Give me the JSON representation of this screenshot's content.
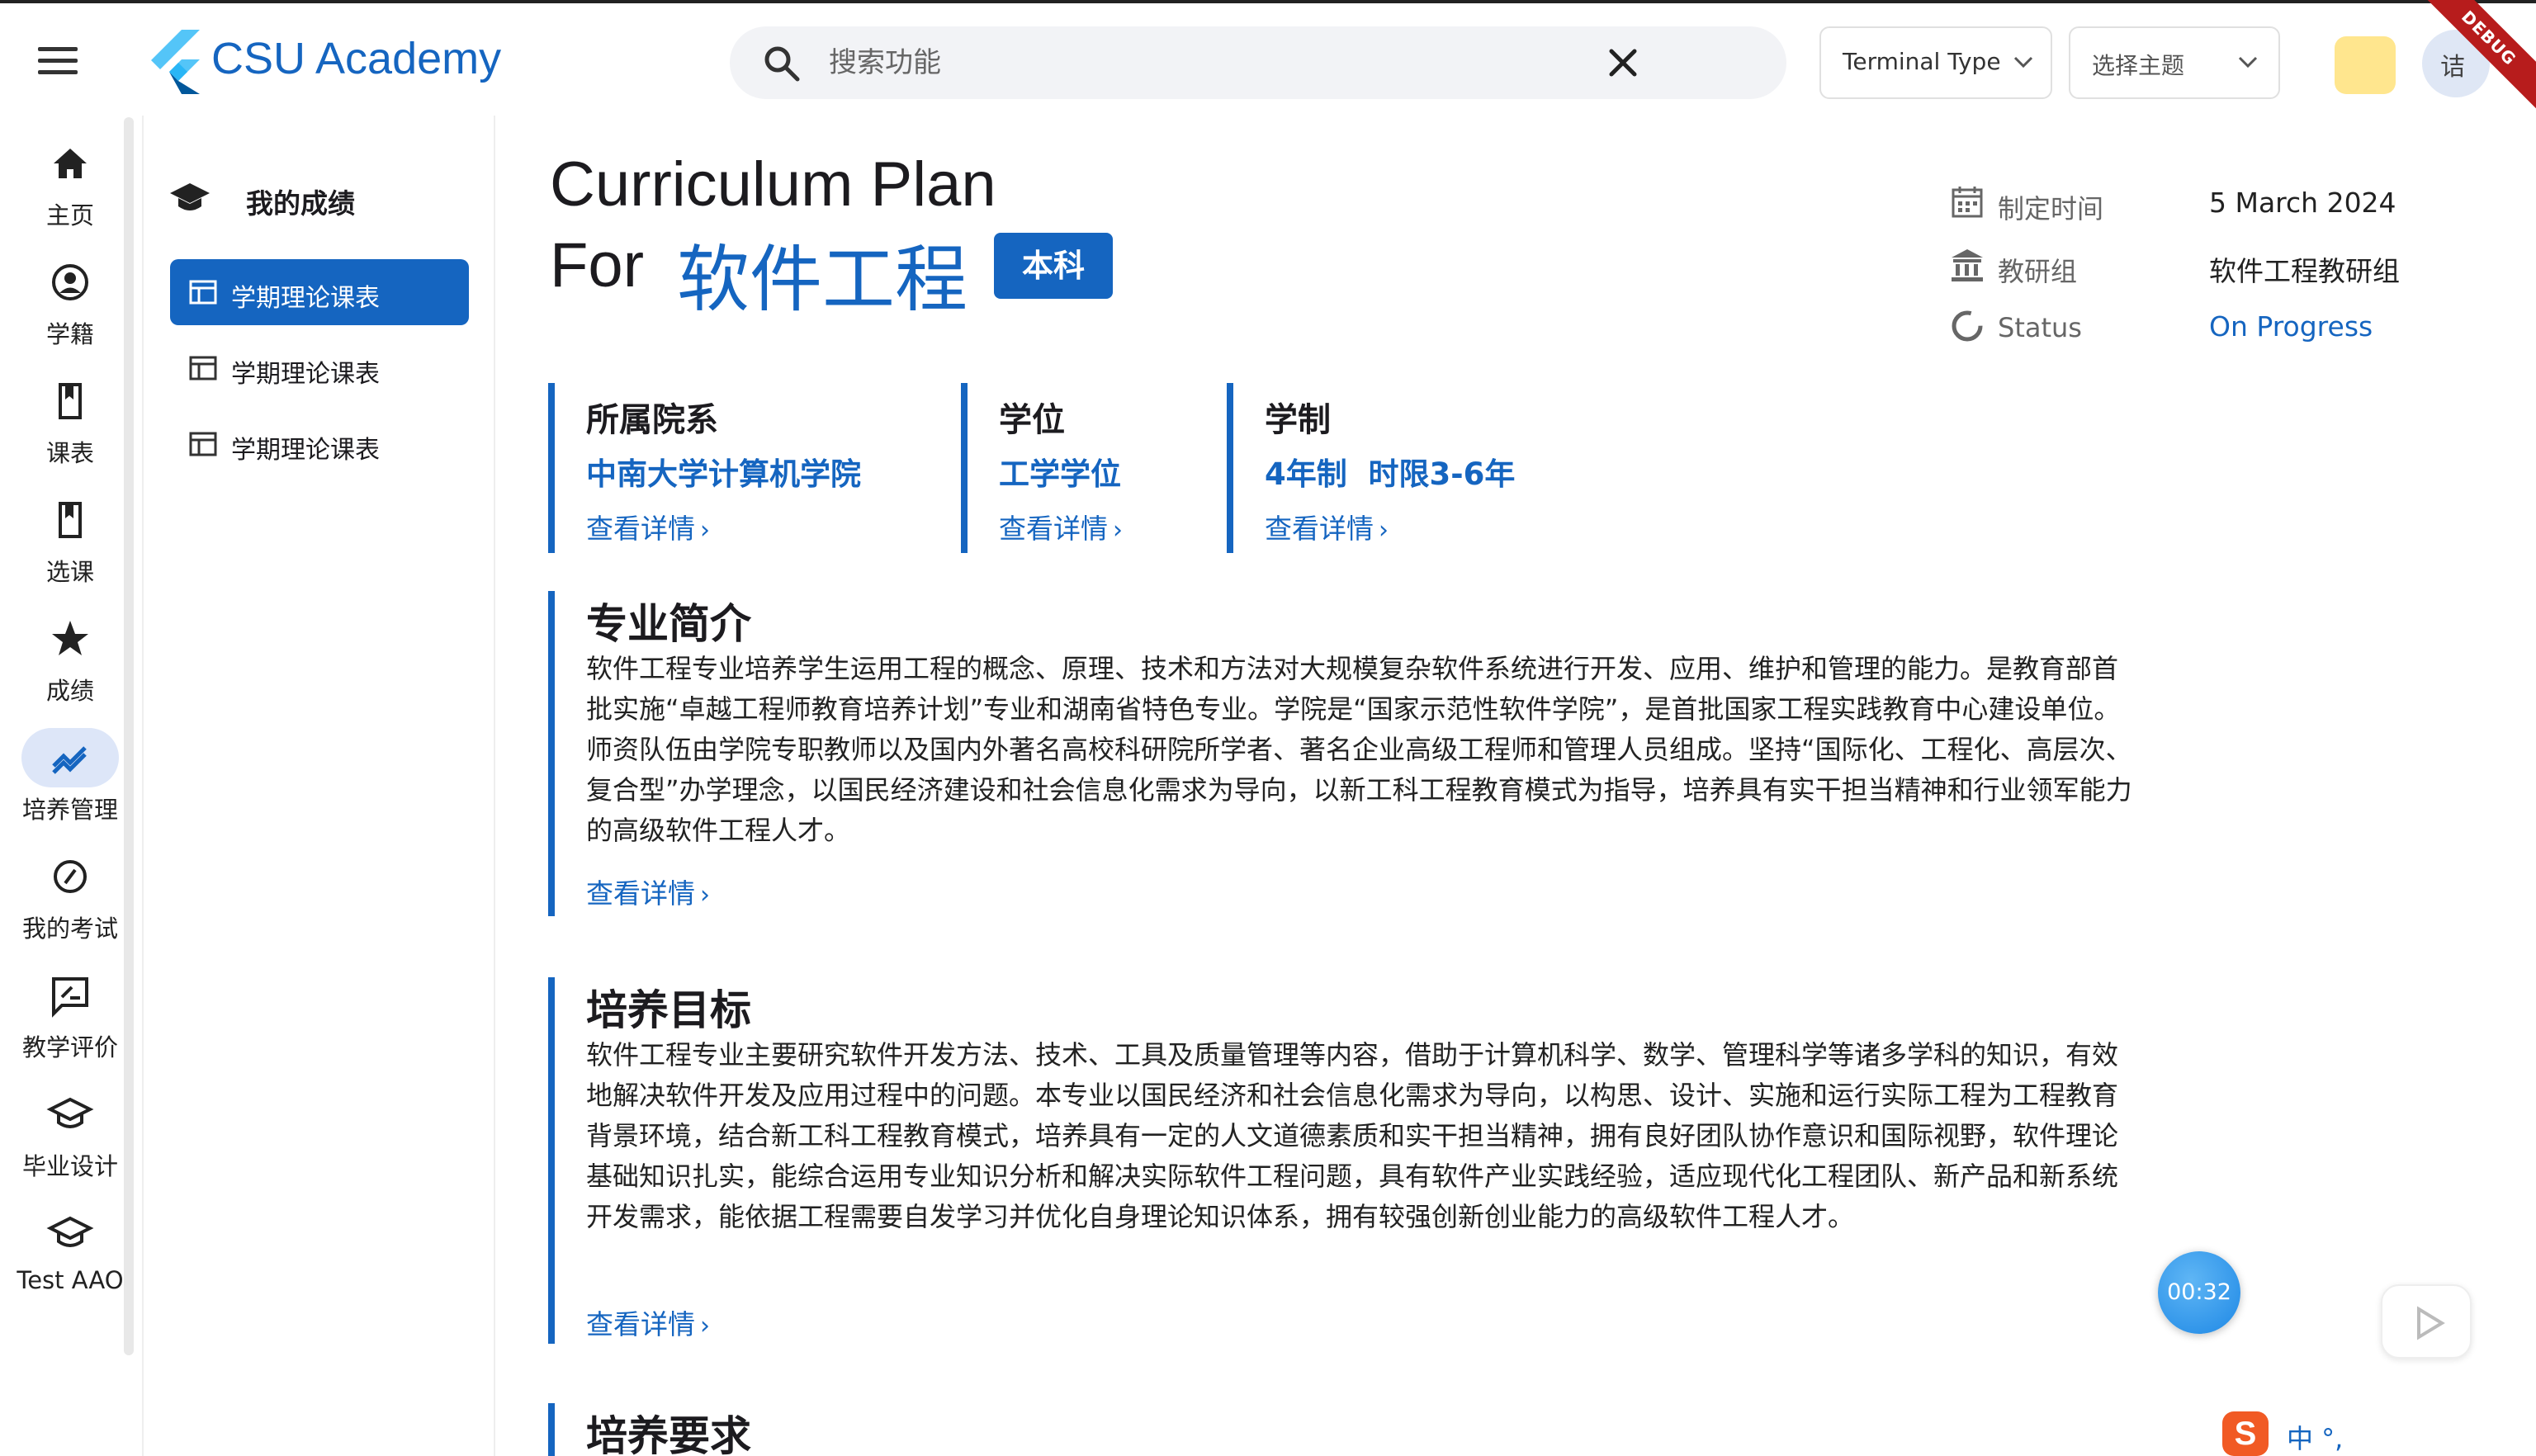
{
  "app": {
    "title": "CSU Academy",
    "debug_banner": "DEBUG",
    "colors": {
      "primary": "#1565c0",
      "rail_active_pill": "#dde6f8",
      "text": "#1c1b1f",
      "muted": "#666666"
    }
  },
  "search": {
    "placeholder": "搜索功能",
    "value": ""
  },
  "header": {
    "terminal_type": "Terminal Type",
    "theme_select": "选择主题",
    "avatar_text": "诘"
  },
  "rail": {
    "items": [
      {
        "label": "主页",
        "icon": "home-icon"
      },
      {
        "label": "学籍",
        "icon": "account-circle-icon"
      },
      {
        "label": "课表",
        "icon": "bookmark-icon"
      },
      {
        "label": "选课",
        "icon": "bookmark-icon"
      },
      {
        "label": "成绩",
        "icon": "star-icon"
      },
      {
        "label": "培养管理",
        "icon": "trending-icon",
        "active": true
      },
      {
        "label": "我的考试",
        "icon": "slash-circle-icon"
      },
      {
        "label": "教学评价",
        "icon": "rate-review-icon"
      },
      {
        "label": "毕业设计",
        "icon": "school-icon"
      },
      {
        "label": "Test AAO",
        "icon": "school-icon"
      }
    ]
  },
  "subnav": {
    "title": "我的成绩",
    "items": [
      {
        "label": "学期理论课表",
        "active": true
      },
      {
        "label": "学期理论课表"
      },
      {
        "label": "学期理论课表"
      }
    ]
  },
  "plan": {
    "title": "Curriculum Plan",
    "for_label": "For",
    "major": "软件工程",
    "degree_level": "本科",
    "meta": {
      "date_label": "制定时间",
      "date_value": "5 March 2024",
      "group_label": "教研组",
      "group_value": "软件工程教研组",
      "status_label": "Status",
      "status_value": "On Progress"
    },
    "cards": [
      {
        "title": "所属院系",
        "value": "中南大学计算机学院",
        "link": "查看详情"
      },
      {
        "title": "学位",
        "value": "工学学位",
        "link": "查看详情"
      },
      {
        "title": "学制",
        "value": "4年制  时限3-6年",
        "link": "查看详情"
      }
    ],
    "sections": [
      {
        "title": "专业简介",
        "body": "软件工程专业培养学生运用工程的概念、原理、技术和方法对大规模复杂软件系统进行开发、应用、维护和管理的能力。是教育部首批实施“卓越工程师教育培养计划”专业和湖南省特色专业。学院是“国家示范性软件学院”，是首批国家工程实践教育中心建设单位。师资队伍由学院专职教师以及国内外著名高校科研院所学者、著名企业高级工程师和管理人员组成。坚持“国际化、工程化、高层次、复合型”办学理念，以国民经济建设和社会信息化需求为导向，以新工科工程教育模式为指导，培养具有实干担当精神和行业领军能力的高级软件工程人才。",
        "link": "查看详情"
      },
      {
        "title": "培养目标",
        "body": "软件工程专业主要研究软件开发方法、技术、工具及质量管理等内容，借助于计算机科学、数学、管理科学等诸多学科的知识，有效地解决软件开发及应用过程中的问题。本专业以国民经济和社会信息化需求为导向，以构思、设计、实施和运行实际工程为工程教育背景环境，结合新工科工程教育模式，培养具有一定的人文道德素质和实干担当精神，拥有良好团队协作意识和国际视野，软件理论基础知识扎实，能综合运用专业知识分析和解决实际软件工程问题，具有软件产业实践经验，适应现代化工程团队、新产品和新系统开发需求，能依据工程需要自发学习并优化自身理论知识体系，拥有较强创新创业能力的高级软件工程人才。",
        "link": "查看详情"
      },
      {
        "title": "培养要求"
      }
    ]
  },
  "overlay": {
    "timer": "00:32",
    "ime_logo": "S",
    "ime_text": "中 °,"
  }
}
